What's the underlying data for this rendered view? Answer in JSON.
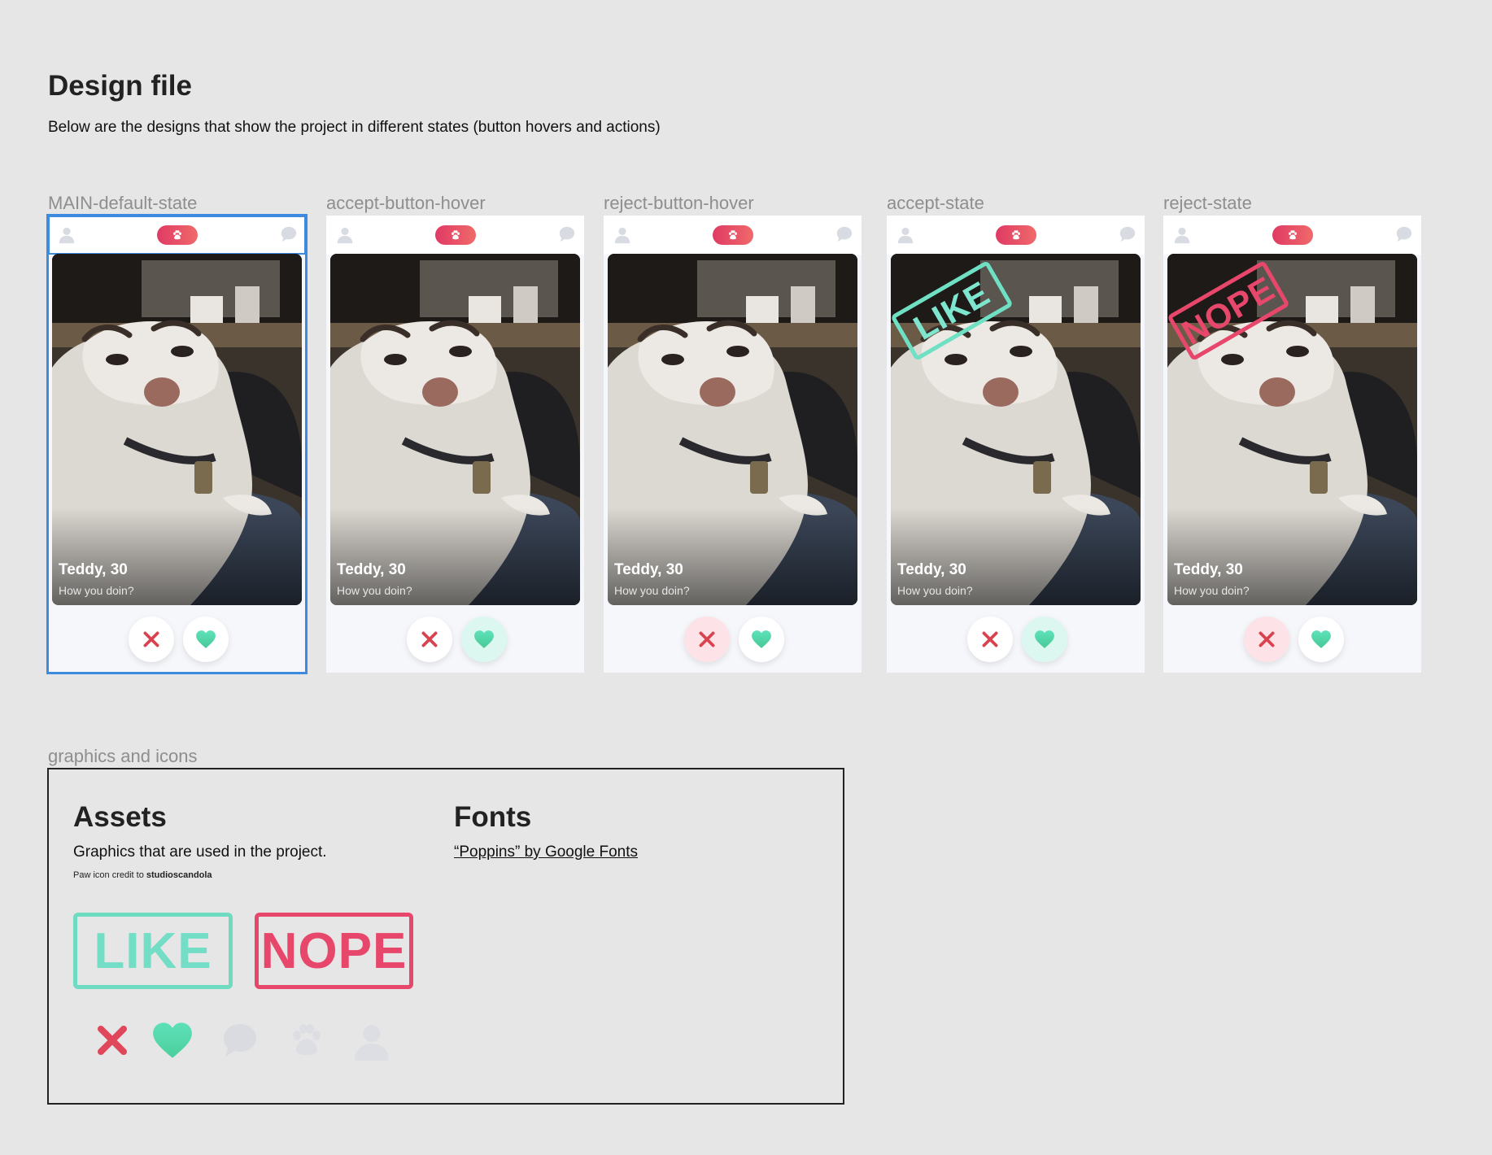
{
  "page": {
    "title": "Design file",
    "subtitle": "Below are the designs that show the project in different states (button hovers and actions)"
  },
  "colors": {
    "brand_gradient": [
      "#e03a64",
      "#ef6a6a"
    ],
    "like": "#6fe0c4",
    "nope": "#e8476c",
    "selection": "#3d8be0",
    "icon_muted": "#d4d7df"
  },
  "icons": {
    "profile": "user-icon",
    "logo": "paw-icon",
    "messages": "chat-icon",
    "reject": "x-icon",
    "accept": "heart-icon"
  },
  "frames": [
    {
      "label": "MAIN-default-state",
      "name": "Teddy, 30",
      "bio": "How you doin?",
      "selected": true,
      "stamp": "",
      "hover": ""
    },
    {
      "label": "accept-button-hover",
      "name": "Teddy, 30",
      "bio": "How you doin?",
      "selected": false,
      "stamp": "",
      "hover": "accept"
    },
    {
      "label": "reject-button-hover",
      "name": "Teddy, 30",
      "bio": "How you doin?",
      "selected": false,
      "stamp": "",
      "hover": "reject"
    },
    {
      "label": "accept-state",
      "name": "Teddy, 30",
      "bio": "How you doin?",
      "selected": false,
      "stamp": "LIKE",
      "hover": "accept"
    },
    {
      "label": "reject-state",
      "name": "Teddy, 30",
      "bio": "How you doin?",
      "selected": false,
      "stamp": "NOPE",
      "hover": "reject"
    }
  ],
  "assets": {
    "section_label": "graphics and icons",
    "title": "Assets",
    "description": "Graphics that are used in the project.",
    "credit_prefix": "Paw icon credit to ",
    "credit_author": "studioscandola",
    "like_stamp": "LIKE",
    "nope_stamp": "NOPE",
    "fonts_title": "Fonts",
    "fonts_link": "“Poppins” by Google Fonts"
  }
}
